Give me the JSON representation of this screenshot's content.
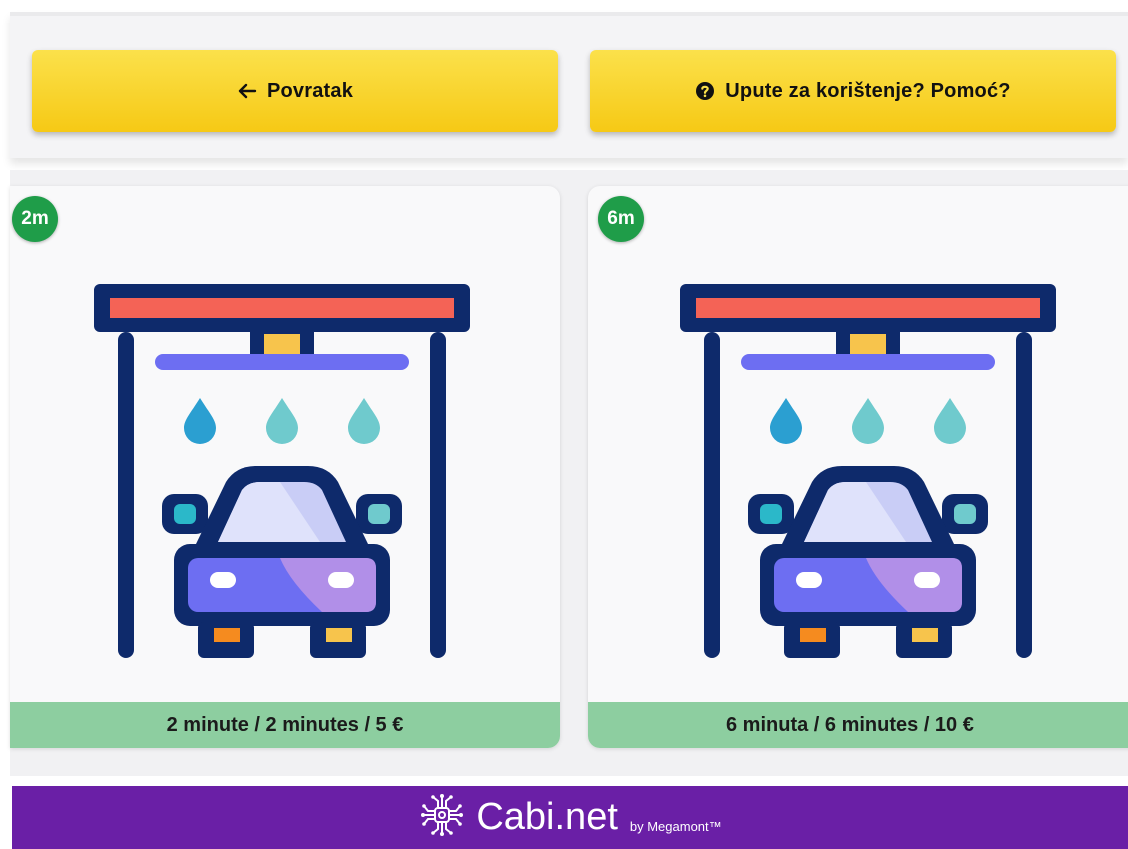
{
  "toolbar": {
    "back_label": "Povratak",
    "back_icon": "arrow-left-icon",
    "help_label": "Upute za korištenje? Pomoć?",
    "help_icon": "question-circle-icon"
  },
  "programs": [
    {
      "badge": "2m",
      "price_label": "2 minute / 2 minutes / 5 €",
      "icon": "car-wash-icon"
    },
    {
      "badge": "6m",
      "price_label": "6 minuta / 6 minutes / 10 €",
      "icon": "car-wash-icon"
    }
  ],
  "footer": {
    "brand_name": "Cabi.net",
    "brand_by": "by Megamont™",
    "logo_icon": "circuit-chip-icon"
  },
  "colors": {
    "button_yellow": "#f6c915",
    "badge_green": "#1f9d49",
    "price_green": "#8dcea0",
    "footer_purple": "#6a1fa6",
    "navy": "#0e2a6b"
  }
}
